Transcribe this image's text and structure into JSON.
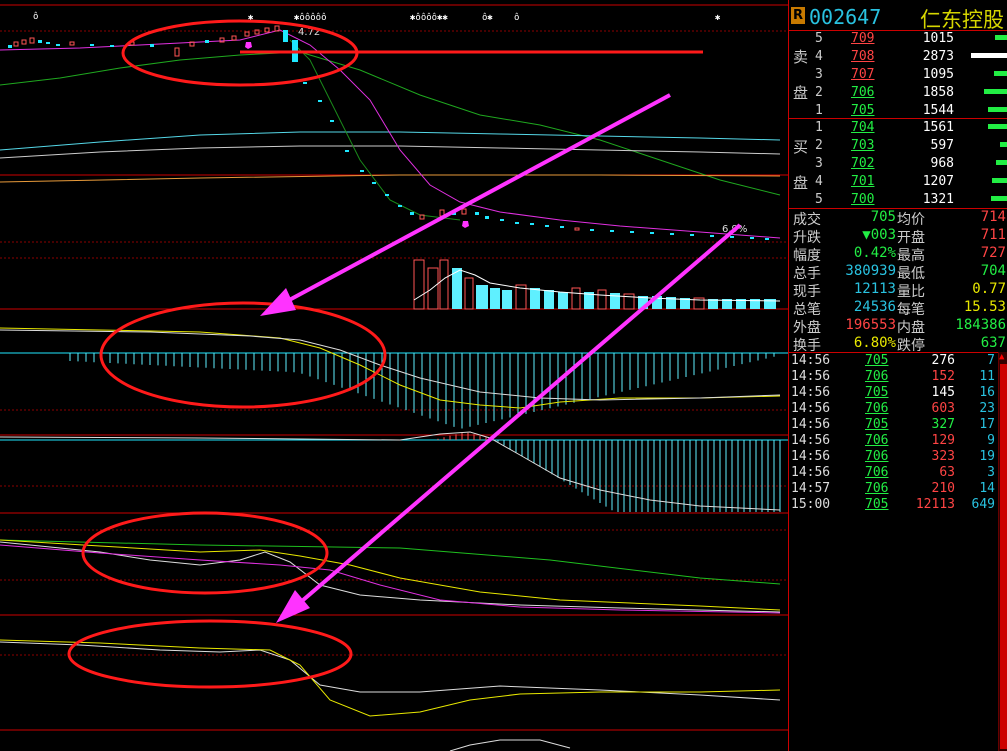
{
  "header": {
    "badge": "R",
    "code": "002647",
    "name": "仁东控股"
  },
  "chart_labels": {
    "price_high_marker": "4.72",
    "price_low_marker": "6.9%"
  },
  "orderbook": {
    "sell_label_1": "卖",
    "sell_label_2": "盘",
    "buy_label_1": "买",
    "buy_label_2": "盘",
    "sell": [
      {
        "level": "5",
        "price": "709",
        "vol": "1015",
        "bar": 0.3,
        "bar_color": "#22ee44"
      },
      {
        "level": "4",
        "price": "708",
        "vol": "2873",
        "bar": 0.85,
        "bar_color": "#ffffff"
      },
      {
        "level": "3",
        "price": "707",
        "vol": "1095",
        "bar": 0.32,
        "bar_color": "#22ee44"
      },
      {
        "level": "2",
        "price": "706",
        "vol": "1858",
        "bar": 0.55,
        "bar_color": "#22ee44"
      },
      {
        "level": "1",
        "price": "705",
        "vol": "1544",
        "bar": 0.45,
        "bar_color": "#22ee44"
      }
    ],
    "buy": [
      {
        "level": "1",
        "price": "704",
        "vol": "1561",
        "bar": 0.45,
        "bar_color": "#22ee44"
      },
      {
        "level": "2",
        "price": "703",
        "vol": "597",
        "bar": 0.18,
        "bar_color": "#22ee44"
      },
      {
        "level": "3",
        "price": "702",
        "vol": "968",
        "bar": 0.28,
        "bar_color": "#22ee44"
      },
      {
        "level": "4",
        "price": "701",
        "vol": "1207",
        "bar": 0.36,
        "bar_color": "#22ee44"
      },
      {
        "level": "5",
        "price": "700",
        "vol": "1321",
        "bar": 0.39,
        "bar_color": "#22ee44"
      }
    ]
  },
  "stats": [
    {
      "l1": "成交",
      "v1": "705",
      "c1": "#22ee44",
      "l2": "均价",
      "v2": "714",
      "c2": "#ff4444"
    },
    {
      "l1": "升跌",
      "v1": "▼003",
      "c1": "#22ee44",
      "l2": "开盘",
      "v2": "711",
      "c2": "#ff4444"
    },
    {
      "l1": "幅度",
      "v1": "0.42%",
      "c1": "#22ee44",
      "l2": "最高",
      "v2": "727",
      "c2": "#ff4444"
    },
    {
      "l1": "总手",
      "v1": "380939",
      "c1": "#29c2e0",
      "l2": "最低",
      "v2": "704",
      "c2": "#22ee44"
    },
    {
      "l1": "现手",
      "v1": "12113",
      "c1": "#29c2e0",
      "l2": "量比",
      "v2": "0.77",
      "c2": "#e8e800"
    },
    {
      "l1": "总笔",
      "v1": "24536",
      "c1": "#29c2e0",
      "l2": "每笔",
      "v2": "15.53",
      "c2": "#e8e800"
    },
    {
      "l1": "外盘",
      "v1": "196553",
      "c1": "#ff4444",
      "l2": "内盘",
      "v2": "184386",
      "c2": "#22ee44"
    },
    {
      "l1": "换手",
      "v1": "6.80%",
      "c1": "#e8e800",
      "l2": "跌停",
      "v2": "637",
      "c2": "#22ee44"
    }
  ],
  "ticks": [
    {
      "t": "14:56",
      "p": "705",
      "pc": "#22ee44",
      "v": "276",
      "vc": "#ffffff",
      "n": "7"
    },
    {
      "t": "14:56",
      "p": "706",
      "pc": "#22ee44",
      "v": "152",
      "vc": "#ff4444",
      "n": "11"
    },
    {
      "t": "14:56",
      "p": "705",
      "pc": "#22ee44",
      "v": "145",
      "vc": "#ffffff",
      "n": "16"
    },
    {
      "t": "14:56",
      "p": "706",
      "pc": "#22ee44",
      "v": "603",
      "vc": "#ff4444",
      "n": "23"
    },
    {
      "t": "14:56",
      "p": "705",
      "pc": "#22ee44",
      "v": "327",
      "vc": "#22ee44",
      "n": "17"
    },
    {
      "t": "14:56",
      "p": "706",
      "pc": "#22ee44",
      "v": "129",
      "vc": "#ff4444",
      "n": "9"
    },
    {
      "t": "14:56",
      "p": "706",
      "pc": "#22ee44",
      "v": "323",
      "vc": "#ff4444",
      "n": "19"
    },
    {
      "t": "14:56",
      "p": "706",
      "pc": "#22ee44",
      "v": "63",
      "vc": "#ff4444",
      "n": "3"
    },
    {
      "t": "14:57",
      "p": "706",
      "pc": "#22ee44",
      "v": "210",
      "vc": "#ff4444",
      "n": "14"
    },
    {
      "t": "15:00",
      "p": "705",
      "pc": "#22ee44",
      "v": "12113",
      "vc": "#ff4444",
      "n": "649"
    }
  ]
}
